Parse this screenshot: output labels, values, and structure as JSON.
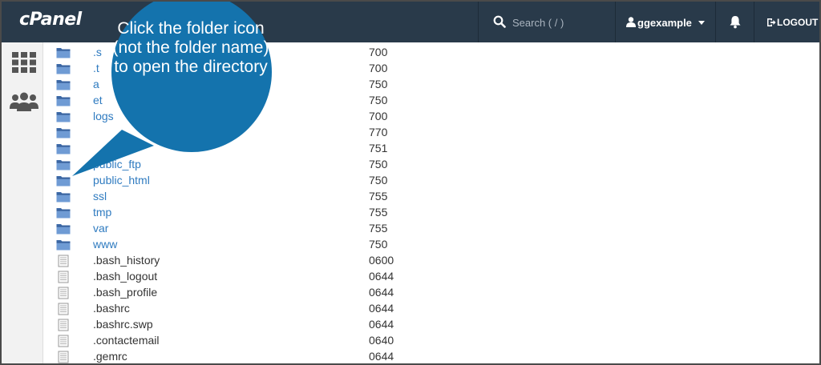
{
  "app": {
    "logo": "cPanel"
  },
  "header": {
    "search_placeholder": "Search ( / )",
    "username": "ggexample",
    "logout_label": "LOGOUT"
  },
  "sidebar": {
    "items": [
      {
        "icon": "apps-grid-icon"
      },
      {
        "icon": "users-icon"
      }
    ]
  },
  "files": [
    {
      "name": ".s",
      "perm": "700",
      "type": "folder"
    },
    {
      "name": ".t",
      "perm": "700",
      "type": "folder"
    },
    {
      "name": "a",
      "perm": "750",
      "type": "folder"
    },
    {
      "name": "et",
      "perm": "750",
      "type": "folder"
    },
    {
      "name": "logs",
      "perm": "700",
      "type": "folder"
    },
    {
      "name": "",
      "perm": "770",
      "type": "folder"
    },
    {
      "name": "",
      "perm": "751",
      "type": "folder"
    },
    {
      "name": "public_ftp",
      "perm": "750",
      "type": "folder"
    },
    {
      "name": "public_html",
      "perm": "750",
      "type": "folder"
    },
    {
      "name": "ssl",
      "perm": "755",
      "type": "folder"
    },
    {
      "name": "tmp",
      "perm": "755",
      "type": "folder"
    },
    {
      "name": "var",
      "perm": "755",
      "type": "folder"
    },
    {
      "name": "www",
      "perm": "750",
      "type": "folder"
    },
    {
      "name": ".bash_history",
      "perm": "0600",
      "type": "file"
    },
    {
      "name": ".bash_logout",
      "perm": "0644",
      "type": "file"
    },
    {
      "name": ".bash_profile",
      "perm": "0644",
      "type": "file"
    },
    {
      "name": ".bashrc",
      "perm": "0644",
      "type": "file"
    },
    {
      "name": ".bashrc.swp",
      "perm": "0644",
      "type": "file"
    },
    {
      "name": ".contactemail",
      "perm": "0640",
      "type": "file"
    },
    {
      "name": ".gemrc",
      "perm": "0644",
      "type": "file"
    }
  ],
  "callout": {
    "text": "Click the folder icon (not the folder name) to open the directory",
    "color": "#1473ad"
  },
  "colors": {
    "topbar": "#293a4a",
    "link": "#2f7bc0",
    "folder": "#5b87c2"
  }
}
